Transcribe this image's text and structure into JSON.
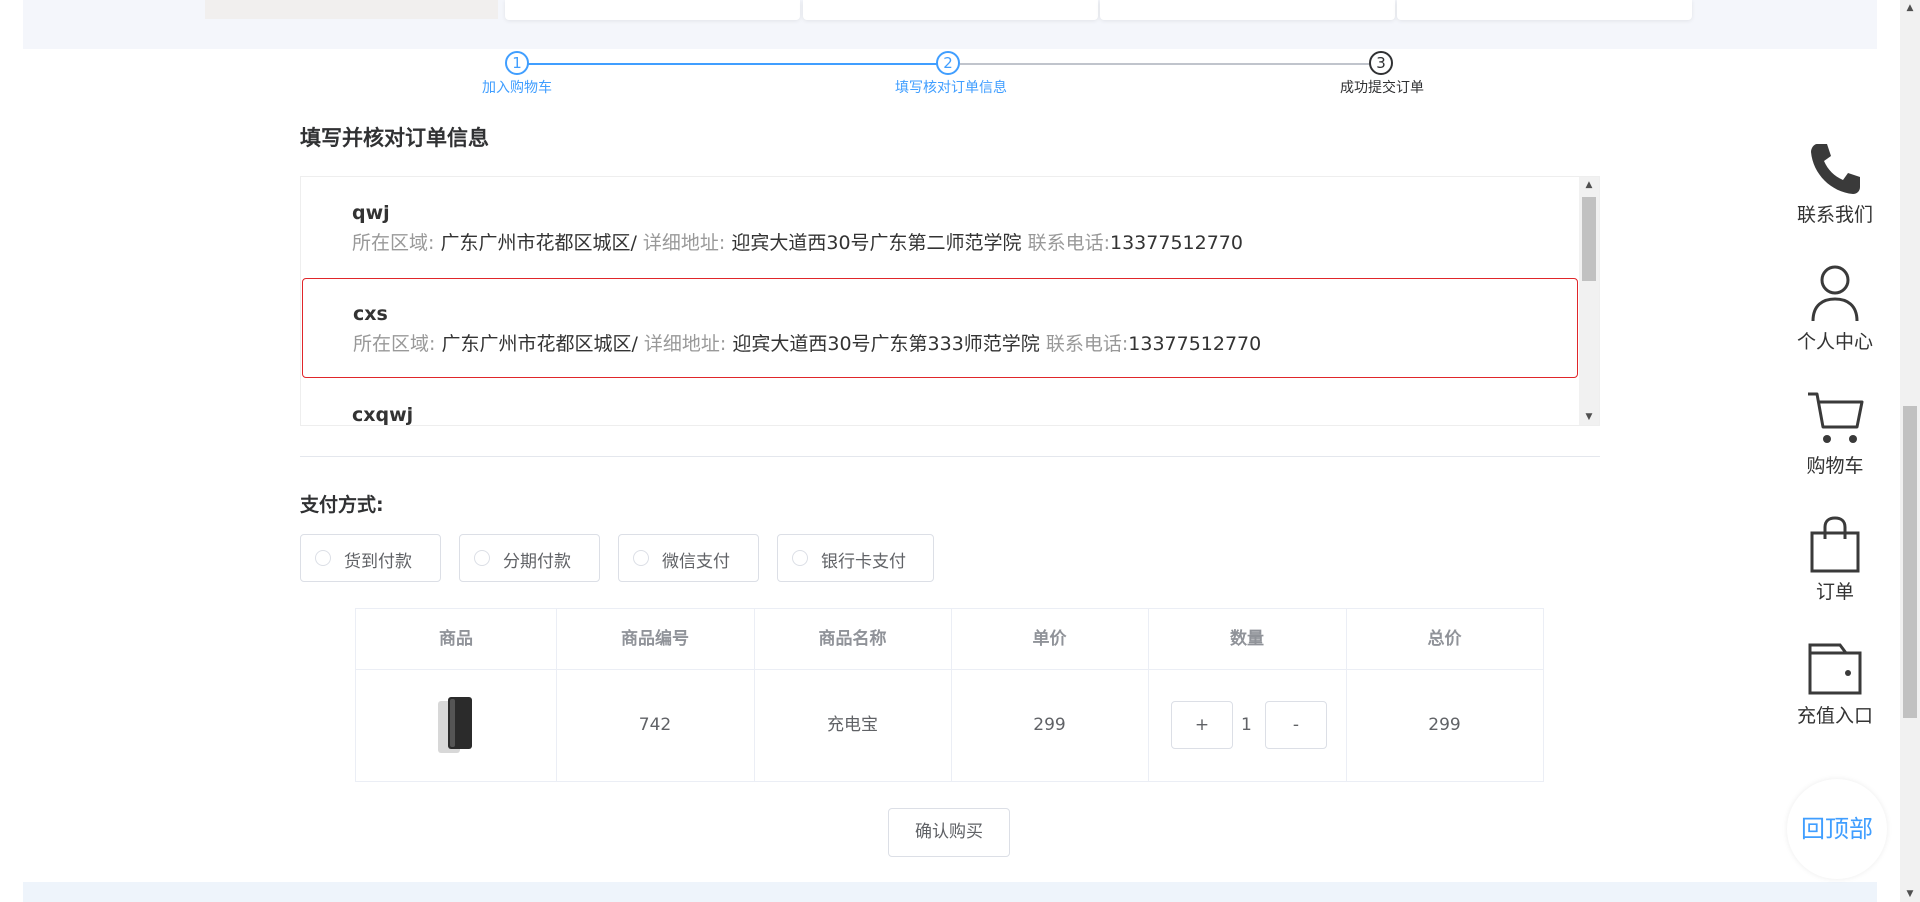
{
  "steps": [
    {
      "number": "1",
      "label": "加入购物车",
      "state": "done"
    },
    {
      "number": "2",
      "label": "填写核对订单信息",
      "state": "active"
    },
    {
      "number": "3",
      "label": "成功提交订单",
      "state": "pending"
    }
  ],
  "page_title": "填写并核对订单信息",
  "address_labels": {
    "region": "所在区域:",
    "detail": "详细地址:",
    "phone": "联系电话:"
  },
  "addresses": [
    {
      "name": "qwj",
      "region": "广东广州市花都区城区/",
      "detail": "迎宾大道西30号广东第二师范学院",
      "phone": "13377512770",
      "selected": false
    },
    {
      "name": "cxs",
      "region": "广东广州市花都区城区/",
      "detail": "迎宾大道西30号广东第333师范学院",
      "phone": "13377512770",
      "selected": true
    },
    {
      "name": "cxqwj"
    }
  ],
  "payment": {
    "title": "支付方式:",
    "options": [
      "货到付款",
      "分期付款",
      "微信支付",
      "银行卡支付"
    ]
  },
  "table": {
    "headers": [
      "商品",
      "商品编号",
      "商品名称",
      "单价",
      "数量",
      "总价"
    ],
    "rows": [
      {
        "image": "powerbank-image",
        "id": "742",
        "name": "充电宝",
        "price": "299",
        "quantity": "1",
        "total": "299"
      }
    ],
    "plus_label": "+",
    "minus_label": "-"
  },
  "confirm_button": "确认购买",
  "sidebar": {
    "items": [
      {
        "label": "联系我们",
        "icon": "phone-icon"
      },
      {
        "label": "个人中心",
        "icon": "user-icon"
      },
      {
        "label": "购物车",
        "icon": "cart-icon"
      },
      {
        "label": "订单",
        "icon": "bag-icon"
      },
      {
        "label": "充值入口",
        "icon": "wallet-icon"
      }
    ],
    "back_to_top": "回顶部"
  },
  "colors": {
    "accent": "#409eff",
    "selected_border": "#e0262a",
    "pending": "#303133"
  }
}
